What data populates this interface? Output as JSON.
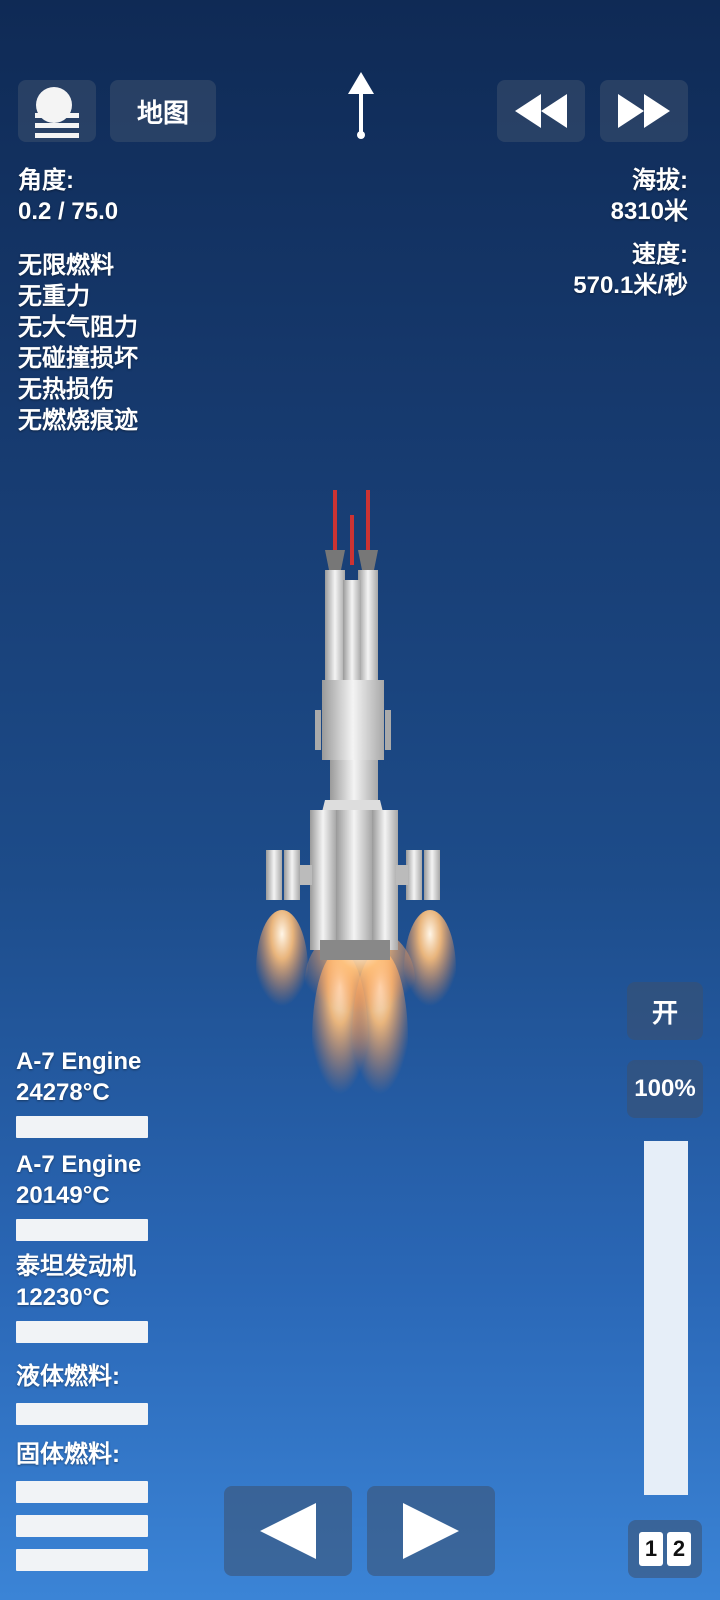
{
  "top_bar": {
    "map_label": "地图",
    "rewind_icon": "rewind-icon",
    "fast_forward_icon": "fast-forward-icon",
    "menu_icon": "menu-icon",
    "direction_icon": "up-arrow-icon"
  },
  "angle": {
    "label": "角度:",
    "value": "0.2 / 75.0"
  },
  "altitude": {
    "label": "海拔:",
    "value": "8310米"
  },
  "speed": {
    "label": "速度:",
    "value": "570.1米/秒"
  },
  "cheats": [
    "无限燃料",
    "无重力",
    "无大气阻力",
    "无碰撞损坏",
    "无热损伤",
    "无燃烧痕迹"
  ],
  "engines": [
    {
      "name": "A-7 Engine",
      "temp": "24278°C"
    },
    {
      "name": "A-7 Engine",
      "temp": "20149°C"
    },
    {
      "name": "泰坦发动机",
      "temp": "12230°C"
    }
  ],
  "fuel": {
    "liquid_label": "液体燃料:",
    "solid_label": "固体燃料:"
  },
  "throttle": {
    "toggle_label": "开",
    "percent_label": "100%",
    "level": 1.0
  },
  "stage": {
    "digit_1": "1",
    "digit_2": "2"
  },
  "controls": {
    "left_icon": "rotate-left-icon",
    "right_icon": "rotate-right-icon"
  },
  "colors": {
    "sky_top": "#0f2a55",
    "sky_bottom": "#3b84d6",
    "button_bg": "#3c506e",
    "bar": "#f1f3f6",
    "flame": "#ffb060"
  }
}
